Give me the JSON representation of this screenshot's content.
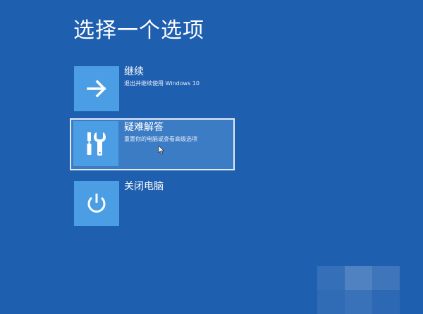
{
  "page": {
    "title": "选择一个选项"
  },
  "options": [
    {
      "title": "继续",
      "description": "退出并继续使用 Windows 10",
      "icon": "arrow-right-icon",
      "selected": false
    },
    {
      "title": "疑难解答",
      "description": "重置你的电脑或查看高级选项",
      "icon": "tools-icon",
      "selected": true
    },
    {
      "title": "关闭电脑",
      "description": "",
      "icon": "power-icon",
      "selected": false
    }
  ],
  "colors": {
    "background": "#1f5fb0",
    "tile": "#4b9ee3",
    "selected_fill": "#3c7cc4",
    "text": "#ffffff"
  }
}
